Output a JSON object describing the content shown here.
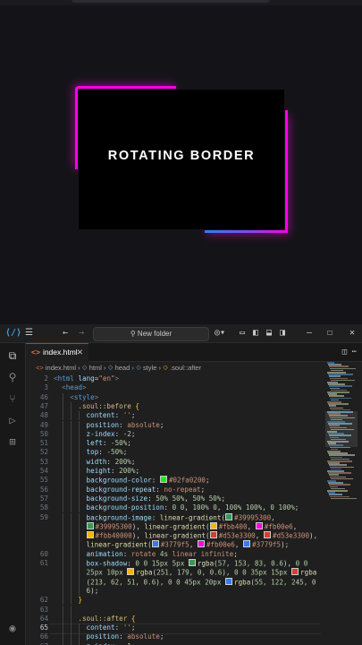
{
  "preview": {
    "title": "ROTATING BORDER",
    "colors": {
      "background": "#141418",
      "box": "#000000",
      "pink": "#fb00e6",
      "blue": "#3779f5"
    }
  },
  "titlebar": {
    "search_placeholder": "New folder",
    "menu_icon": "hamburger-icon",
    "nav_back": "←",
    "nav_forward": "→"
  },
  "tabs": [
    {
      "label": "index.html",
      "icon": "html-file-icon"
    }
  ],
  "breadcrumb": [
    "index.html",
    "html",
    "head",
    "style",
    ".soul::after"
  ],
  "editor": {
    "lines": [
      {
        "n": "2",
        "html": "<span class=\"t-br\">&lt;</span><span class=\"t-tag\">html</span> <span class=\"t-attr\">lang</span>=<span class=\"t-str\">\"en\"</span><span class=\"t-br\">&gt;</span>",
        "indent": 0
      },
      {
        "n": "3",
        "html": "<span class=\"t-br\">&lt;</span><span class=\"t-tag\">head</span><span class=\"t-br\">&gt;</span>",
        "indent": 1
      },
      {
        "n": "46",
        "html": "<span class=\"t-br\">&lt;</span><span class=\"t-tag\">style</span><span class=\"t-br\">&gt;</span>",
        "indent": 2
      },
      {
        "n": "47",
        "html": "<span class=\"t-sel\">.soul::before</span> <span class=\"t-y\">{</span>",
        "indent": 3
      },
      {
        "n": "48",
        "html": "<span class=\"t-prop\">content</span>: <span class=\"t-str\">''</span>;",
        "indent": 4
      },
      {
        "n": "49",
        "html": "<span class=\"t-prop\">position</span>: <span class=\"t-kw\">absolute</span>;",
        "indent": 4
      },
      {
        "n": "50",
        "html": "<span class=\"t-prop\">z-index</span>: <span class=\"t-num\">-2</span>;",
        "indent": 4
      },
      {
        "n": "51",
        "html": "<span class=\"t-prop\">left</span>: <span class=\"t-num\">-50%</span>;",
        "indent": 4
      },
      {
        "n": "52",
        "html": "<span class=\"t-prop\">top</span>: <span class=\"t-num\">-50%</span>;",
        "indent": 4
      },
      {
        "n": "53",
        "html": "<span class=\"t-prop\">width</span>: <span class=\"t-num\">200%</span>;",
        "indent": 4
      },
      {
        "n": "54",
        "html": "<span class=\"t-prop\">height</span>: <span class=\"t-num\">200%</span>;",
        "indent": 4
      },
      {
        "n": "55",
        "html": "<span class=\"t-prop\">background-color</span>: <span class=\"sw\" style=\"background:#02fa02\"></span><span class=\"t-kw\">#02fa0200</span>;",
        "indent": 4
      },
      {
        "n": "56",
        "html": "<span class=\"t-prop\">background-repeat</span>: <span class=\"t-kw\">no-repeat</span>;",
        "indent": 4
      },
      {
        "n": "57",
        "html": "<span class=\"t-prop\">background-size</span>: <span class=\"t-num\">50% 50%</span>, <span class=\"t-num\">50% 50%</span>;",
        "indent": 4
      },
      {
        "n": "58",
        "html": "<span class=\"t-prop\">background-position</span>: <span class=\"t-num\">0 0</span>, <span class=\"t-num\">100% 0</span>, <span class=\"t-num\">100% 100%</span>, <span class=\"t-num\">0 100%</span>;",
        "indent": 4
      },
      {
        "n": "59",
        "html": "<span class=\"t-prop\">background-image</span>: <span class=\"t-fn\">linear-gradient</span>(<span class=\"sw\" style=\"background:#399953\"></span><span class=\"t-kw\">#39995300</span>,",
        "indent": 4
      },
      {
        "n": "",
        "html": "<span class=\"sw\" style=\"background:#399953\"></span><span class=\"t-kw\">#39995300</span>), <span class=\"t-fn\">linear-gradient</span>(<span class=\"sw\" style=\"background:#fbb400\"></span><span class=\"t-kw\">#fbb400</span>, <span class=\"sw\" style=\"background:#fb00e6\"></span><span class=\"t-kw\">#fb00e6</span>,",
        "indent": 4
      },
      {
        "n": "",
        "html": "<span class=\"sw\" style=\"background:#fbb400\"></span><span class=\"t-kw\">#fbb40000</span>), <span class=\"t-fn\">linear-gradient</span>(<span class=\"sw\" style=\"background:#d53e33\"></span><span class=\"t-kw\">#d53e3300</span>, <span class=\"sw\" style=\"background:#d53e33\"></span><span class=\"t-kw\">#d53e3300</span>),",
        "indent": 4
      },
      {
        "n": "",
        "html": "<span class=\"t-fn\">linear-gradient</span>(<span class=\"sw\" style=\"background:#3779f5\"></span><span class=\"t-kw\">#3779f5</span>, <span class=\"sw\" style=\"background:#fb00e6\"></span><span class=\"t-kw\">#fb00e6</span>, <span class=\"sw\" style=\"background:#3779f5\"></span><span class=\"t-kw\">#3779f5</span>);",
        "indent": 4
      },
      {
        "n": "60",
        "html": "<span class=\"t-prop\">animation</span>: <span class=\"t-kw\">rotate</span> <span class=\"t-num\">4s</span> <span class=\"t-kw\">linear infinite</span>;",
        "indent": 4
      },
      {
        "n": "61",
        "html": "<span class=\"t-prop\">box-shadow</span>: <span class=\"t-num\">0 0 15px 5px</span> <span class=\"sw\" style=\"background:rgb(57,153,83)\"></span><span class=\"t-fn\">rgba</span>(<span class=\"t-num\">57, 153, 83, 0.6</span>), <span class=\"t-num\">0 0</span>",
        "indent": 4
      },
      {
        "n": "",
        "html": "<span class=\"t-num\">25px 10px</span> <span class=\"sw\" style=\"background:rgb(251,179,0)\"></span><span class=\"t-fn\">rgba</span>(<span class=\"t-num\">251, 179, 0, 0.6</span>), <span class=\"t-num\">0 0 35px 15px</span> <span class=\"sw\" style=\"background:rgb(213,62,51)\"></span><span class=\"t-fn\">rgba</span>",
        "indent": 4
      },
      {
        "n": "",
        "html": "(<span class=\"t-num\">213, 62, 51, 0.6</span>), <span class=\"t-num\">0 0 45px 20px</span> <span class=\"sw\" style=\"background:rgb(55,122,245)\"></span><span class=\"t-fn\">rgba</span>(<span class=\"t-num\">55, 122, 245, 0</span>",
        "indent": 4
      },
      {
        "n": "",
        "html": "<span class=\"t-num\">6</span>);",
        "indent": 4
      },
      {
        "n": "62",
        "html": "<span class=\"t-y\">}</span>",
        "indent": 3
      },
      {
        "n": "63",
        "html": "",
        "indent": 3
      },
      {
        "n": "64",
        "html": "<span class=\"t-sel\">.soul::after</span> <span class=\"t-y\">{</span>",
        "indent": 3
      },
      {
        "n": "65",
        "html": "<span class=\"t-prop\">content</span>: <span class=\"t-str\">''</span>;",
        "indent": 4,
        "active": true
      },
      {
        "n": "66",
        "html": "<span class=\"t-prop\">position</span>: <span class=\"t-kw\">absolute</span>;",
        "indent": 4
      },
      {
        "n": "67",
        "html": "<span class=\"t-prop\">z-index</span>: <span class=\"t-num\">-1</span>;",
        "indent": 4
      }
    ]
  }
}
